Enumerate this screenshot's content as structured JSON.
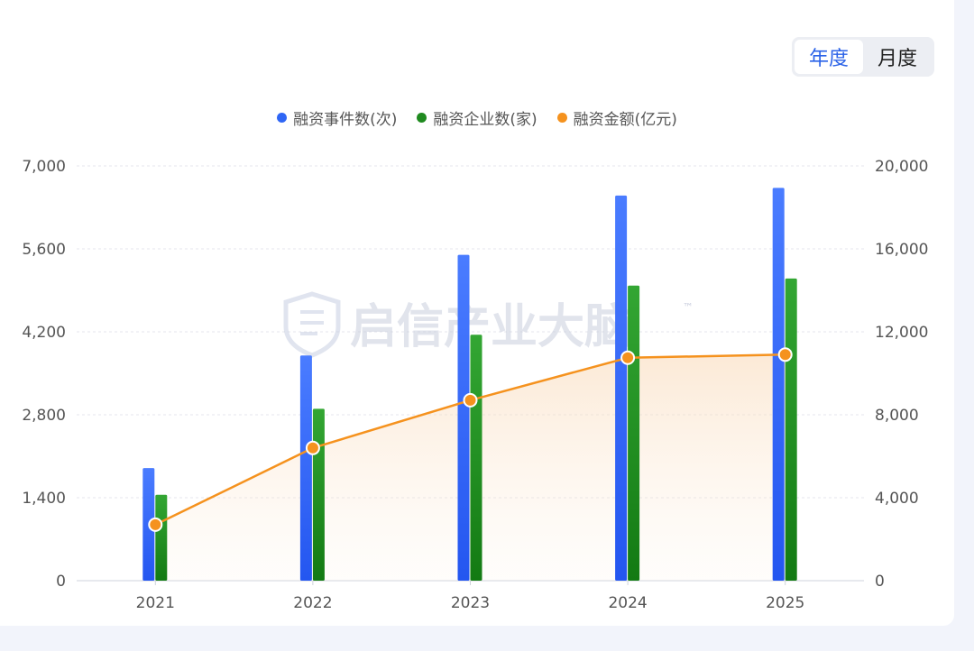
{
  "toggle": {
    "year_label": "年度",
    "month_label": "月度"
  },
  "watermark": {
    "text": "启信产业大脑",
    "tm": "™"
  },
  "colors": {
    "events": "#2f66f5",
    "companies": "#1f8a1f",
    "amount": "#f5921e"
  },
  "chart_data": {
    "type": "bar",
    "title": "",
    "categories": [
      "2021",
      "2022",
      "2023",
      "2024",
      "2025"
    ],
    "series": [
      {
        "name": "融资事件数(次)",
        "kind": "bar",
        "axis": "left",
        "values": [
          1900,
          3800,
          5500,
          6500,
          6630
        ]
      },
      {
        "name": "融资企业数(家)",
        "kind": "bar",
        "axis": "left",
        "values": [
          1450,
          2900,
          4150,
          4980,
          5100
        ]
      },
      {
        "name": "融资金额(亿元)",
        "kind": "line",
        "axis": "right",
        "values": [
          2700,
          6400,
          8700,
          10750,
          10900
        ]
      }
    ],
    "y_left": {
      "lim": [
        0,
        7000
      ],
      "ticks": [
        "0",
        "1,400",
        "2,800",
        "4,200",
        "5,600",
        "7,000"
      ]
    },
    "y_right": {
      "lim": [
        0,
        20000
      ],
      "ticks": [
        "0",
        "4,000",
        "8,000",
        "12,000",
        "16,000",
        "20,000"
      ]
    },
    "legend_position": "top-center",
    "grid": true
  }
}
